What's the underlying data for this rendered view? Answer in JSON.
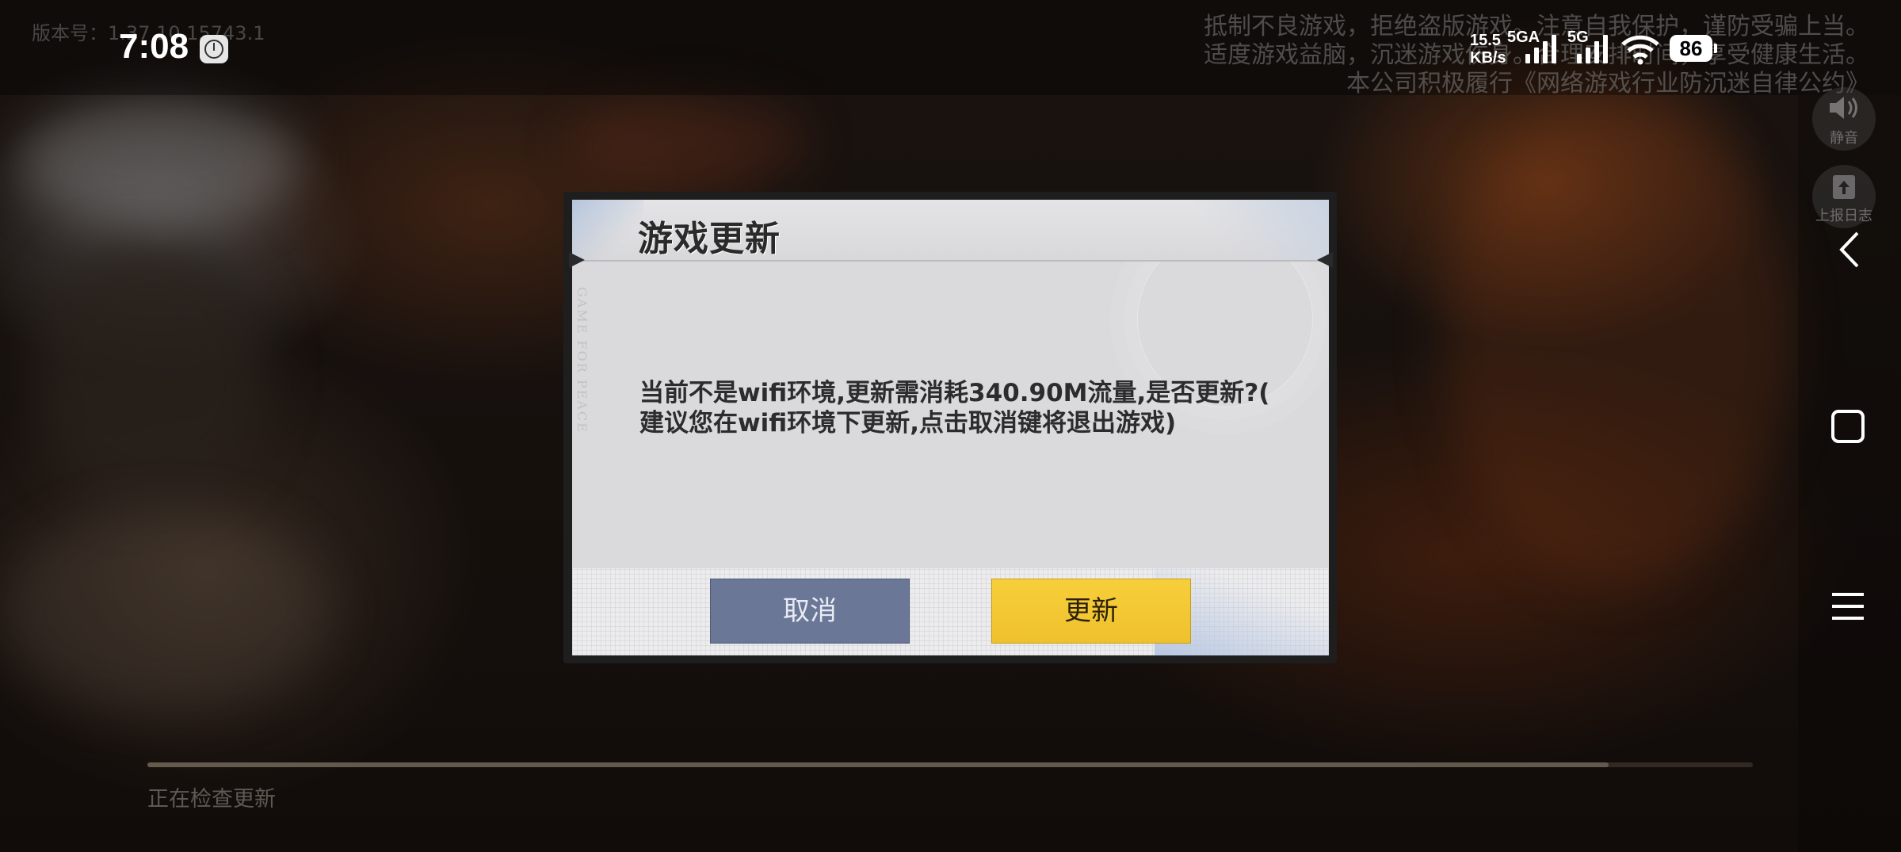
{
  "status_bar": {
    "version_text": "版本号：1.37.10.15743.1",
    "time": "7:08",
    "net_speed_value": "15.5",
    "net_speed_unit": "KB/s",
    "signal1_label": "5GA",
    "signal2_label": "5G",
    "battery": "86"
  },
  "notice": {
    "line1": "抵制不良游戏，拒绝盗版游戏。注意自我保护，谨防受骗上当。",
    "line2": "适度游戏益脑，沉迷游戏伤身。合理安排时间，享受健康生活。",
    "line3": "本公司积极履行《网络游戏行业防沉迷自律公约》"
  },
  "side_tools": {
    "mute_label": "静音",
    "report_label": "上报日志"
  },
  "dialog": {
    "title": "游戏更新",
    "side_text": "GAME FOR PEACE",
    "message_line1": "当前不是wifi环境,更新需消耗340.90M流量,是否更新?(",
    "message_line2": "建议您在wifi环境下更新,点击取消键将退出游戏)",
    "cancel_label": "取消",
    "update_label": "更新"
  },
  "progress": {
    "text": "正在检查更新",
    "fraction": 0.91
  },
  "colors": {
    "update_button": "#f2c532",
    "cancel_button": "#6a7796"
  }
}
